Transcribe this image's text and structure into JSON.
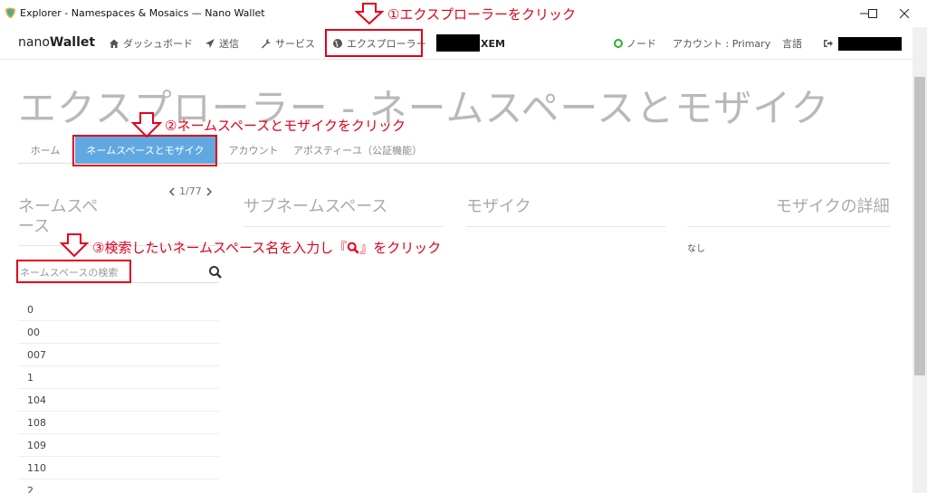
{
  "window": {
    "title": "Explorer - Namespaces & Mosaics — Nano Wallet",
    "controls": {
      "minimize": "—",
      "maximize": "☐",
      "close": "✕"
    }
  },
  "nav": {
    "brand_a": "nano",
    "brand_b": "Wallet",
    "dashboard": "ダッシュボード",
    "send": "送信",
    "services": "サービス",
    "explorer": "エクスプローラー",
    "balance_unit": "XEM",
    "node": "ノード",
    "account": "アカウント : Primary",
    "language": "言語"
  },
  "page": {
    "title": "エクスプローラー - ネームスペースとモザイク"
  },
  "tabs": [
    "ホーム",
    "ネームスペースとモザイク",
    "アカウント",
    "アポスティーユ（公証機能）"
  ],
  "columns": {
    "namespace_line1": "ネームスペ",
    "namespace_line2": "ース",
    "subnamespace": "サブネームスペース",
    "mosaic": "モザイク",
    "mosaic_detail": "モザイクの詳細",
    "pager": "1/77",
    "none": "なし"
  },
  "search": {
    "placeholder": "ネームスペースの検索"
  },
  "namespaces": [
    "0",
    "00",
    "007",
    "1",
    "104",
    "108",
    "109",
    "110",
    "2"
  ],
  "annotations": {
    "step1": "①エクスプローラーをクリック",
    "step2": "②ネームスペースとモザイクをクリック",
    "step3": "③検索したいネームスペース名を入力し『",
    "step3_end": "』をクリック"
  },
  "colors": {
    "annotation_red": "#e2001a",
    "tab_active": "#62a8e0",
    "node_green": "#2bb02b",
    "title_gray": "#b9b9b9"
  }
}
